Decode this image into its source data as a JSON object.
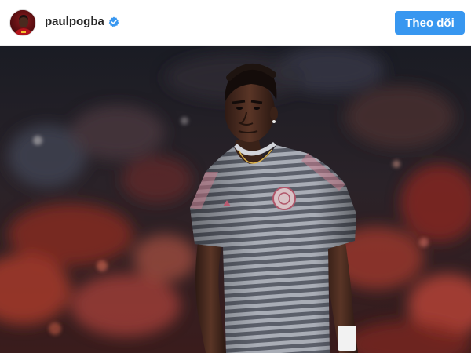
{
  "post": {
    "username": "paulpogba",
    "follow_label": "Theo dõi",
    "verified": true
  },
  "colors": {
    "follow_button": "#3897f0",
    "verified_badge": "#3897f0",
    "username_text": "#262626",
    "photo_background": "#1c1d24"
  },
  "icons": {
    "verified": "verified-badge-icon"
  }
}
